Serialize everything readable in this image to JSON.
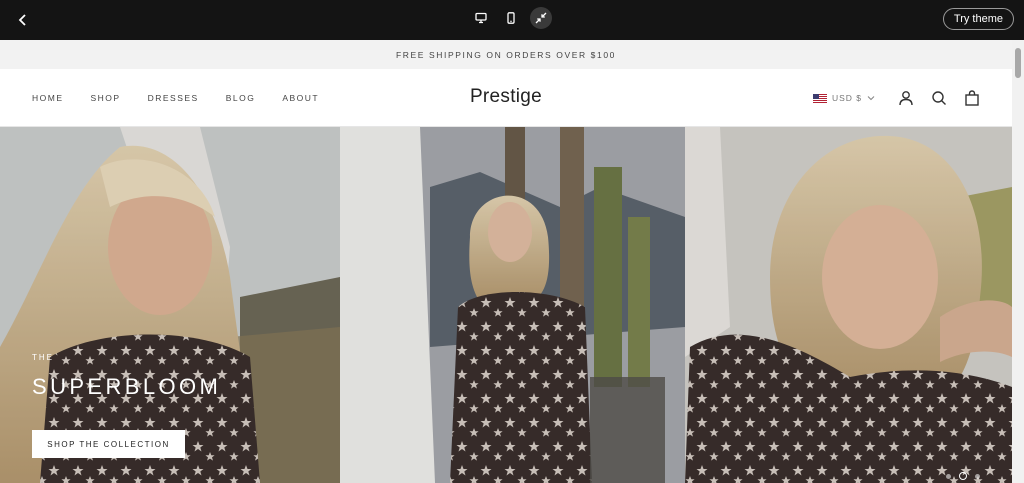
{
  "editor": {
    "try_theme": "Try theme",
    "device_icons": [
      "desktop-icon",
      "mobile-icon",
      "collapse-icon"
    ]
  },
  "store": {
    "announcement": "FREE SHIPPING ON ORDERS OVER $100",
    "logo": "Prestige",
    "nav": [
      "HOME",
      "SHOP",
      "DRESSES",
      "BLOG",
      "ABOUT"
    ],
    "currency": "USD $"
  },
  "hero": {
    "kicker": "THE",
    "headline": "SUPERBLOOM",
    "cta": "SHOP THE COLLECTION",
    "slides_count": 3,
    "active_slide": 2
  },
  "colors": {
    "editor_bar": "#141414",
    "announcement_bg": "#f2f2f2",
    "text": "#444444"
  }
}
